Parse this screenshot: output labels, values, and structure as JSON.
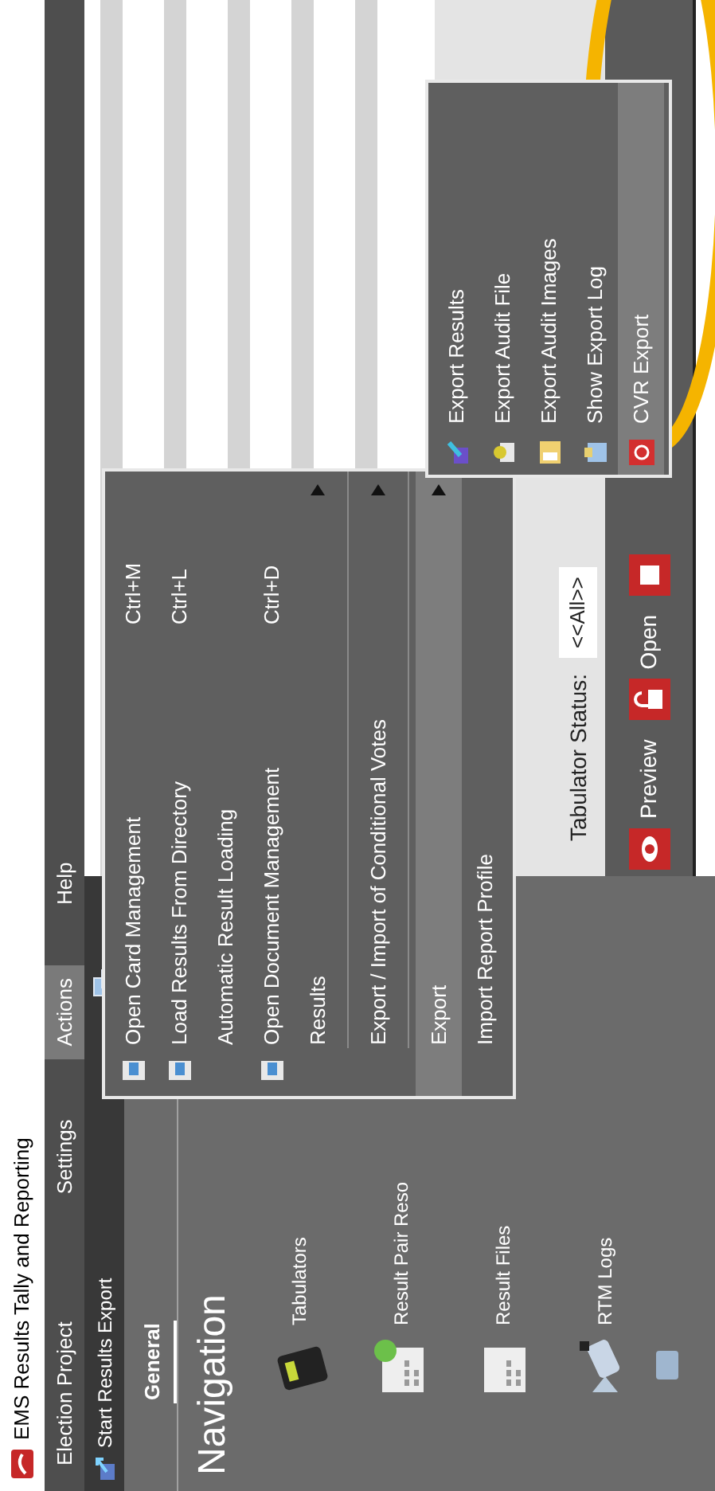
{
  "window": {
    "title": "EMS Results Tally and Reporting"
  },
  "menu_bar": [
    {
      "label": "Election Project",
      "selected": false
    },
    {
      "label": "Settings",
      "selected": false
    },
    {
      "label": "Actions",
      "selected": true
    },
    {
      "label": "Help",
      "selected": false
    }
  ],
  "toolbar": [
    {
      "label": "Start Results Export"
    }
  ],
  "navigation": {
    "title": "Navigation",
    "tabs": [
      {
        "label": "General",
        "selected": true
      }
    ],
    "items": [
      {
        "label": "Tabulators"
      },
      {
        "label": "Result Pair Reso"
      },
      {
        "label": "Result Files"
      },
      {
        "label": "RTM Logs"
      }
    ]
  },
  "tabulator_filter": {
    "label": "Tabulator Status:",
    "value": "<<All>>"
  },
  "content_toolbar": [
    {
      "label": "Preview"
    },
    {
      "label": "Open"
    }
  ],
  "actions_menu": [
    {
      "kind": "item",
      "label": "Open Card Management",
      "shortcut": "Ctrl+M",
      "icon": true,
      "submenu": false,
      "selected": false
    },
    {
      "kind": "item",
      "label": "Load Results From Directory",
      "shortcut": "Ctrl+L",
      "icon": true,
      "submenu": false,
      "selected": false
    },
    {
      "kind": "item",
      "label": "Automatic Result Loading",
      "icon": false,
      "submenu": false,
      "selected": false
    },
    {
      "kind": "item",
      "label": "Open Document Management",
      "shortcut": "Ctrl+D",
      "icon": true,
      "submenu": false,
      "selected": false
    },
    {
      "kind": "item",
      "label": "Results",
      "icon": false,
      "submenu": true,
      "selected": false
    },
    {
      "kind": "separator"
    },
    {
      "kind": "item",
      "label": "Export / Import of Conditional Votes",
      "icon": false,
      "submenu": true,
      "selected": false
    },
    {
      "kind": "separator"
    },
    {
      "kind": "item",
      "label": "Export",
      "icon": false,
      "submenu": true,
      "selected": true
    },
    {
      "kind": "item",
      "label": "Import Report Profile",
      "icon": false,
      "submenu": false,
      "selected": false
    }
  ],
  "export_submenu": [
    {
      "label": "Export Results",
      "selected": false
    },
    {
      "label": "Export Audit File",
      "selected": false
    },
    {
      "label": "Export Audit Images",
      "selected": false
    },
    {
      "label": "Show Export Log",
      "selected": false
    },
    {
      "label": "CVR Export",
      "selected": true
    }
  ]
}
